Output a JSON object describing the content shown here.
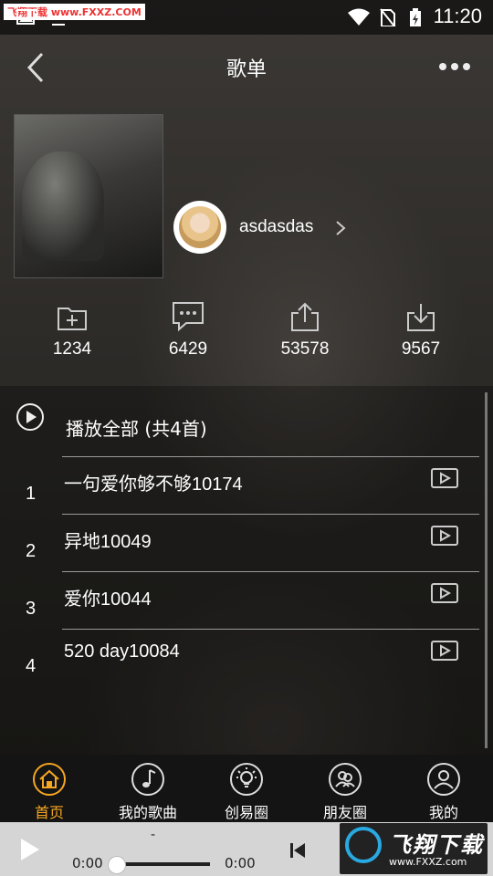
{
  "status_bar": {
    "time": "11:20",
    "watermark": "飞翔下载 www.FXXZ.COM",
    "icons": [
      "image-icon",
      "download-icon",
      "wifi-icon",
      "no-sim-icon",
      "battery-charging-icon"
    ]
  },
  "header": {
    "title": "歌单",
    "back_icon": "back-arrow-icon",
    "more_icon": "more-dots-icon"
  },
  "playlist": {
    "username": "asdasdas",
    "stats": [
      {
        "icon": "add-folder-icon",
        "count": "1234"
      },
      {
        "icon": "comment-icon",
        "count": "6429"
      },
      {
        "icon": "share-icon",
        "count": "53578"
      },
      {
        "icon": "download-icon",
        "count": "9567"
      }
    ]
  },
  "songs": {
    "play_all_label": "播放全部 (共4首)",
    "items": [
      {
        "index": "1",
        "name": "一句爱你够不够10174"
      },
      {
        "index": "2",
        "name": "异地10049"
      },
      {
        "index": "3",
        "name": "爱你10044"
      },
      {
        "index": "4",
        "name": "520 day10084"
      }
    ]
  },
  "tabs": [
    {
      "label": "首页",
      "icon": "home-icon",
      "active": true
    },
    {
      "label": "我的歌曲",
      "icon": "music-note-icon",
      "active": false
    },
    {
      "label": "创易圈",
      "icon": "bulb-icon",
      "active": false
    },
    {
      "label": "朋友圈",
      "icon": "friends-icon",
      "active": false
    },
    {
      "label": "我的",
      "icon": "user-icon",
      "active": false
    }
  ],
  "player": {
    "song_title": "-",
    "current_time": "0:00",
    "total_time": "0:00",
    "progress": 0
  },
  "colors": {
    "accent": "#f5a623",
    "tab_bar_bg": "#141414",
    "player_bg": "#d5d5d5"
  }
}
